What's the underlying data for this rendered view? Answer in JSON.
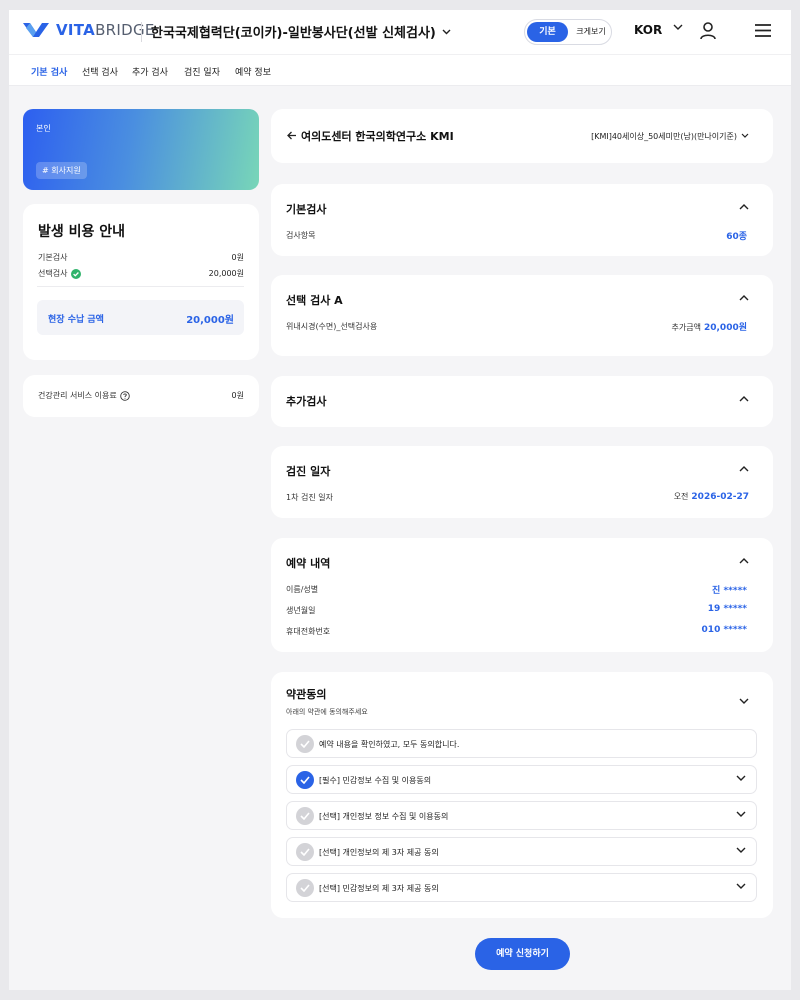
{
  "header": {
    "logo_vita": "VITA",
    "logo_bridge": "BRIDGE",
    "org_title": "한국국제협력단(코이카)-일반봉사단(선발 신체검사)",
    "view_toggle": {
      "basic": "기본",
      "large": "크게보기"
    },
    "language": "KOR"
  },
  "subnav": [
    "기본 검사",
    "선택 검사",
    "추가 검사",
    "검진 일자",
    "예약 정보"
  ],
  "profile": {
    "relation": "본인",
    "tag": "# 회사지원"
  },
  "cost": {
    "title": "발생 비용 안내",
    "rows": [
      {
        "label": "기본검사",
        "value": "0원"
      },
      {
        "label": "선택검사",
        "value": "20,000원"
      }
    ],
    "onsite_label": "현장 수납 금액",
    "onsite_value": "20,000원"
  },
  "service_fee": {
    "label": "건강관리 서비스 이용료",
    "value": "0원"
  },
  "center": {
    "name": "여의도센터 한국의학연구소 KMI",
    "package": "[KMI]40세이상_50세미만(남)(만나이기준)"
  },
  "basic_exam": {
    "title": "기본검사",
    "label": "검사항목",
    "value": "60종"
  },
  "option_a": {
    "title": "선택 검사 A",
    "label": "위내시경(수면)_선택검사용",
    "value_prefix": "추가금액",
    "value": "20,000원"
  },
  "additional": {
    "title": "추가검사"
  },
  "exam_date": {
    "title": "검진 일자",
    "label": "1차 검진 일자",
    "value_prefix": "오전",
    "value": "2026-02-27"
  },
  "reservation": {
    "title": "예약 내역",
    "rows": [
      {
        "label": "이름/성별",
        "value": "진 *****"
      },
      {
        "label": "생년월일",
        "value": "19 *****"
      },
      {
        "label": "휴대전화번호",
        "value": "010 *****"
      }
    ]
  },
  "terms": {
    "title": "약관동의",
    "subtitle": "아래의 약관에 동의해주세요",
    "all_agree": "예약 내용을 확인하였고, 모두 동의합니다.",
    "items": [
      {
        "label": "[필수] 민감정보 수집 및 이용동의",
        "checked": true
      },
      {
        "label": "[선택] 개인정보 정보 수집 및 이용동의",
        "checked": false
      },
      {
        "label": "[선택] 개인정보의 제 3자 제공 동의",
        "checked": false
      },
      {
        "label": "[선택] 민감정보의 제 3자 제공 동의",
        "checked": false
      }
    ]
  },
  "submit_label": "예약 신청하기",
  "colors": {
    "accent": "#2a63e6",
    "check_green": "#2fb36b",
    "page_bg": "#f5f5f7"
  }
}
